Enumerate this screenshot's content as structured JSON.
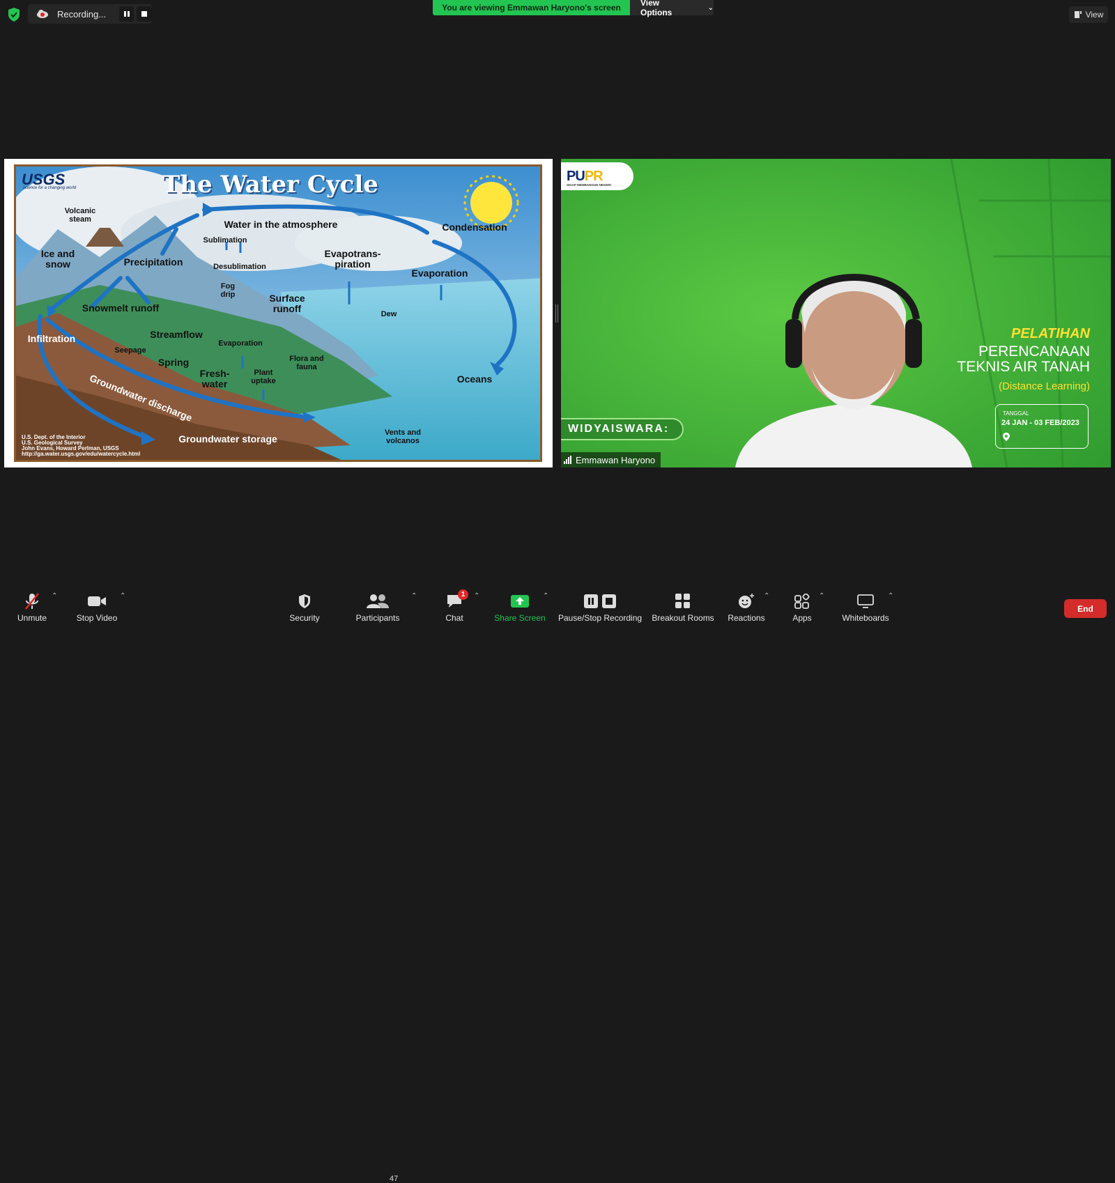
{
  "topbar": {
    "recording_label": "Recording...",
    "viewing_banner": "You are viewing Emmawan Haryono's screen",
    "view_options_label": "View Options",
    "view_label": "View"
  },
  "shared_screen": {
    "logo_text": "USGS",
    "logo_tagline": "science for a changing world",
    "title": "The Water Cycle",
    "labels": {
      "volcanic_steam": "Volcanic steam",
      "ice_snow": "Ice and snow",
      "precipitation": "Precipitation",
      "water_atmosphere": "Water in the atmosphere",
      "sublimation": "Sublimation",
      "desublimation": "Desublimation",
      "condensation": "Condensation",
      "evapotranspiration": "Evapotrans-piration",
      "evaporation": "Evaporation",
      "fog_drip": "Fog drip",
      "snowmelt_runoff": "Snowmelt runoff",
      "surface_runoff": "Surface runoff",
      "dew": "Dew",
      "infiltration": "Infiltration",
      "streamflow": "Streamflow",
      "seepage": "Seepage",
      "evaporation_2": "Evaporation",
      "spring": "Spring",
      "flora_fauna": "Flora and fauna",
      "fresh_water": "Fresh-water",
      "plant_uptake": "Plant uptake",
      "oceans": "Oceans",
      "groundwater_discharge": "Groundwater discharge",
      "groundwater_storage": "Groundwater storage",
      "vents_volcanos": "Vents and volcanos"
    },
    "credits": [
      "U.S. Dept. of the Interior",
      "U.S. Geological Survey",
      "John Evans, Howard Perlman, USGS",
      "http://ga.water.usgs.gov/edu/watercycle.html"
    ]
  },
  "webcam": {
    "logo_main": "PU",
    "logo_accent": "PR",
    "logo_sub": "SIGAP MEMBANGUN NEGERI",
    "pelatihan": "PELATIHAN",
    "line1": "PERENCANAAN",
    "line2": "TEKNIS AIR TANAH",
    "distance_learning": "(Distance Learning)",
    "date_label": "TANGGAL",
    "date_value": "24 JAN - 03 FEB/2023",
    "widyaiswara": "WIDYAISWARA:",
    "participant_name": "Emmawan Haryono"
  },
  "toolbar": {
    "unmute": "Unmute",
    "stop_video": "Stop Video",
    "security": "Security",
    "participants": "Participants",
    "participants_count": "47",
    "chat": "Chat",
    "chat_badge": "1",
    "share_screen": "Share Screen",
    "pause_stop_recording": "Pause/Stop Recording",
    "breakout_rooms": "Breakout Rooms",
    "reactions": "Reactions",
    "apps": "Apps",
    "whiteboards": "Whiteboards",
    "end": "End"
  },
  "colors": {
    "background": "#1a1a1a",
    "share_green": "#23c552",
    "end_red": "#d42b2b",
    "webcam_green": "#3fb43a",
    "pel_yellow": "#ffe033"
  }
}
